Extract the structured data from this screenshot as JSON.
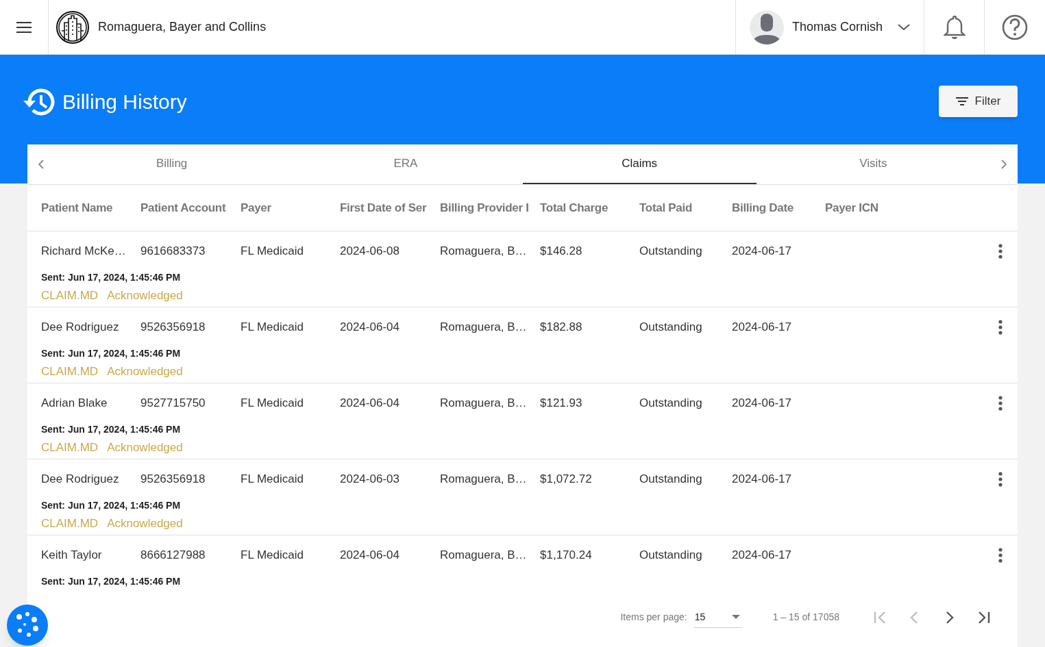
{
  "header": {
    "company": "Romaguera, Bayer and Collins",
    "user": "Thomas Cornish"
  },
  "page": {
    "title": "Billing History",
    "filter_button": "Filter"
  },
  "tabs": [
    {
      "label": "Billing",
      "selected": false
    },
    {
      "label": "ERA",
      "selected": false
    },
    {
      "label": "Claims",
      "selected": true
    },
    {
      "label": "Visits",
      "selected": false
    }
  ],
  "table": {
    "columns": [
      "Patient Name",
      "Patient Account",
      "Payer",
      "First Date of Ser",
      "Billing Provider I",
      "Total Charge",
      "Total Paid",
      "Billing Date",
      "Payer ICN"
    ],
    "rows": [
      {
        "cells": [
          "Richard McKe…",
          "9616683373",
          "FL Medicaid",
          "2024-06-08",
          "Romaguera, B…",
          "$146.28",
          "Outstanding",
          "2024-06-17"
        ],
        "sent": "Sent: Jun 17, 2024, 1:45:46 PM",
        "clearinghouse": "CLAIM.MD",
        "status": "Acknowledged"
      },
      {
        "cells": [
          "Dee Rodriguez",
          "9526356918",
          "FL Medicaid",
          "2024-06-04",
          "Romaguera, B…",
          "$182.88",
          "Outstanding",
          "2024-06-17"
        ],
        "sent": "Sent: Jun 17, 2024, 1:45:46 PM",
        "clearinghouse": "CLAIM.MD",
        "status": "Acknowledged"
      },
      {
        "cells": [
          "Adrian Blake",
          "9527715750",
          "FL Medicaid",
          "2024-06-04",
          "Romaguera, B…",
          "$121.93",
          "Outstanding",
          "2024-06-17"
        ],
        "sent": "Sent: Jun 17, 2024, 1:45:46 PM",
        "clearinghouse": "CLAIM.MD",
        "status": "Acknowledged"
      },
      {
        "cells": [
          "Dee Rodriguez",
          "9526356918",
          "FL Medicaid",
          "2024-06-03",
          "Romaguera, B…",
          "$1,072.72",
          "Outstanding",
          "2024-06-17"
        ],
        "sent": "Sent: Jun 17, 2024, 1:45:46 PM",
        "clearinghouse": "CLAIM.MD",
        "status": "Acknowledged"
      },
      {
        "cells": [
          "Keith Taylor",
          "8666127988",
          "FL Medicaid",
          "2024-06-04",
          "Romaguera, B…",
          "$1,170.24",
          "Outstanding",
          "2024-06-17"
        ],
        "sent": "Sent: Jun 17, 2024, 1:45:46 PM"
      }
    ]
  },
  "paginator": {
    "label": "Items per page:",
    "page_size": "15",
    "range": "1 – 15 of 17058",
    "first_disabled": true,
    "previous_disabled": true,
    "next_disabled": false,
    "last_disabled": false
  }
}
